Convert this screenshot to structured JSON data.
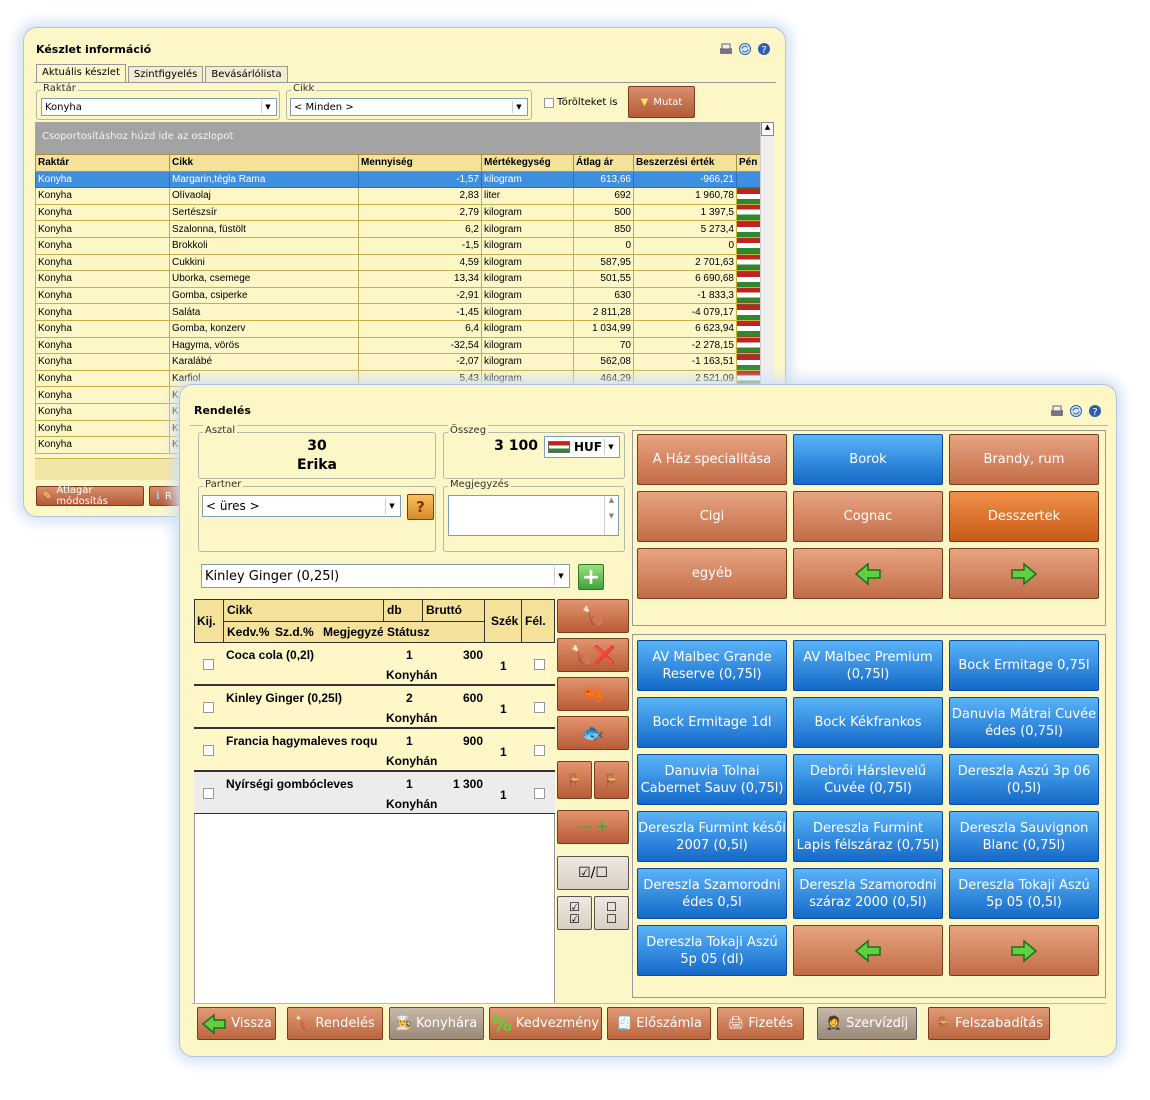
{
  "stock": {
    "title": "Készlet információ",
    "tabs": [
      "Aktuális készlet",
      "Szintfigyelés",
      "Bevásárlólista"
    ],
    "warehouse_label": "Raktár",
    "warehouse_value": "Konyha",
    "item_label": "Cikk",
    "item_value": "< Minden >",
    "deleted_label": "Törölteket is",
    "show_button": "Mutat",
    "group_hint": "Csoportosításhoz húzd ide az oszlopot",
    "columns": [
      "Raktár",
      "Cikk",
      "Mennyiség",
      "Mértékegység",
      "Átlag ár",
      "Beszerzési érték",
      "Pén"
    ],
    "rows": [
      [
        "Konyha",
        "Margarin,tégla Rama",
        "-1,57",
        "kilogram",
        "613,66",
        "-966,21"
      ],
      [
        "Konyha",
        "Olívaolaj",
        "2,83",
        "liter",
        "692",
        "1 960,78"
      ],
      [
        "Konyha",
        "Sertészsír",
        "2,79",
        "kilogram",
        "500",
        "1 397,5"
      ],
      [
        "Konyha",
        "Szalonna, füstölt",
        "6,2",
        "kilogram",
        "850",
        "5 273,4"
      ],
      [
        "Konyha",
        "Brokkoli",
        "-1,5",
        "kilogram",
        "0",
        "0"
      ],
      [
        "Konyha",
        "Cukkini",
        "4,59",
        "kilogram",
        "587,95",
        "2 701,63"
      ],
      [
        "Konyha",
        "Uborka, csemege",
        "13,34",
        "kilogram",
        "501,55",
        "6 690,68"
      ],
      [
        "Konyha",
        "Gomba, csiperke",
        "-2,91",
        "kilogram",
        "630",
        "-1 833,3"
      ],
      [
        "Konyha",
        "Saláta",
        "-1,45",
        "kilogram",
        "2 811,28",
        "-4 079,17"
      ],
      [
        "Konyha",
        "Gomba, konzerv",
        "6,4",
        "kilogram",
        "1 034,99",
        "6 623,94"
      ],
      [
        "Konyha",
        "Hagyma, vörös",
        "-32,54",
        "kilogram",
        "70",
        "-2 278,15"
      ],
      [
        "Konyha",
        "Karalábé",
        "-2,07",
        "kilogram",
        "562,08",
        "-1 163,51"
      ],
      [
        "Konyha",
        "Karfiol",
        "5,43",
        "kilogram",
        "464,29",
        "2 521,09"
      ],
      [
        "Konyha",
        "K",
        "",
        "",
        "",
        ""
      ],
      [
        "Konyha",
        "K",
        "",
        "",
        "",
        ""
      ],
      [
        "Konyha",
        "K",
        "",
        "",
        "",
        ""
      ],
      [
        "Konyha",
        "K",
        "",
        "",
        "",
        ""
      ]
    ],
    "avg_button": "Átlagár módosítás",
    "second_button": "R"
  },
  "order": {
    "title": "Rendelés",
    "table_label": "Asztal",
    "table_number": "30",
    "table_name": "Erika",
    "sum_label": "Összeg",
    "sum_value": "3 100",
    "currency": "HUF",
    "partner_label": "Partner",
    "partner_value": "< üres >",
    "partner_help": "?",
    "note_label": "Megjegyzés",
    "product_value": "Kinley Ginger (0,25l)",
    "grid_head": {
      "kij": "Kij.",
      "cikk": "Cikk",
      "db": "db",
      "brutto": "Bruttó",
      "kedv": "Kedv.%",
      "szd": "Sz.d.%",
      "megj": "Megjegyzés",
      "status": "Státusz",
      "szek": "Szék",
      "fel": "Fél."
    },
    "items": [
      {
        "name": "Coca cola (0,2l)",
        "qty": "1",
        "price": "300",
        "status": "Konyhán",
        "seat": "1"
      },
      {
        "name": "Kinley Ginger (0,25l)",
        "qty": "2",
        "price": "600",
        "status": "Konyhán",
        "seat": "1"
      },
      {
        "name": "Francia hagymaleves roqu",
        "qty": "1",
        "price": "900",
        "status": "Konyhán",
        "seat": "1"
      },
      {
        "name": "Nyírségi gombócleves",
        "qty": "1",
        "price": "1 300",
        "status": "Konyhán",
        "seat": "1"
      }
    ],
    "categories": [
      "A Ház specialitása",
      "Borok",
      "Brandy, rum",
      "Cigi",
      "Cognac",
      "Desszertek",
      "egyéb"
    ],
    "products": [
      "AV Malbec Grande Reserve (0,75l)",
      "AV Malbec Premium (0,75l)",
      "Bock Ermitage 0,75l",
      "Bock Ermitage 1dl",
      "Bock Kékfrankos",
      "Danuvia Mátrai Cuvée édes (0,75l)",
      "Danuvia Tolnai Cabernet Sauv (0,75l)",
      "Debrői Hárslevelű Cuvée (0,75l)",
      "Dereszla Aszú 3p 06 (0,5l)",
      "Dereszla Furmint késői 2007 (0,5l)",
      "Dereszla Furmint Lapis félszáraz (0,75l)",
      "Dereszla Sauvignon Blanc (0,75l)",
      "Dereszla Szamorodni édes 0,5l",
      "Dereszla Szamorodni száraz 2000 (0,5l)",
      "Dereszla Tokaji Aszú 5p 05 (0,5l)",
      "Dereszla Tokaji Aszú 5p 05 (dl)"
    ],
    "bottom_buttons": [
      "Vissza",
      "Rendelés",
      "Konyhára",
      "Kedvezmény",
      "Előszámla",
      "Fizetés",
      "Szervízdíj",
      "Felszabadítás"
    ],
    "colors": {
      "accent_blue": "#1469c8",
      "accent_brown": "#c26c48",
      "selected_row": "#3f8fe0",
      "window_bg": "#fdf6c7"
    }
  }
}
